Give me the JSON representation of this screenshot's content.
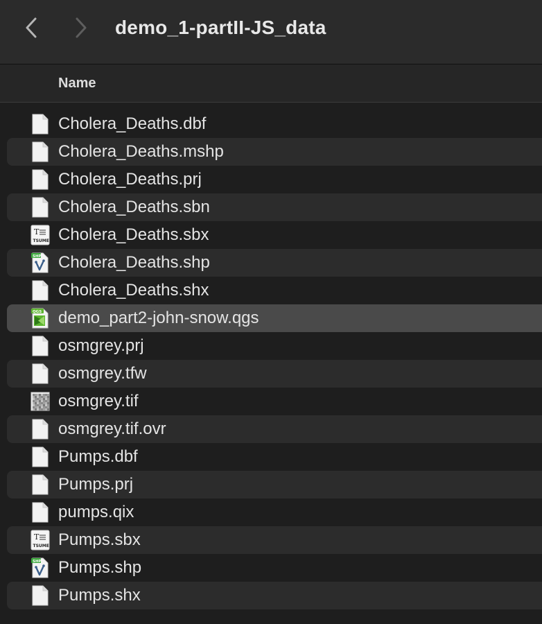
{
  "window": {
    "title": "demo_1-partII-JS_data"
  },
  "header": {
    "name_column": "Name"
  },
  "files": [
    {
      "name": "Cholera_Deaths.dbf",
      "icon": "generic-file-icon"
    },
    {
      "name": "Cholera_Deaths.mshp",
      "icon": "generic-file-icon"
    },
    {
      "name": "Cholera_Deaths.prj",
      "icon": "generic-file-icon"
    },
    {
      "name": "Cholera_Deaths.sbn",
      "icon": "generic-file-icon"
    },
    {
      "name": "Cholera_Deaths.sbx",
      "icon": "tsume-file-icon",
      "icon_text": "TSUME"
    },
    {
      "name": "Cholera_Deaths.shp",
      "icon": "shp-file-icon",
      "icon_text": "SHP"
    },
    {
      "name": "Cholera_Deaths.shx",
      "icon": "generic-file-icon"
    },
    {
      "name": "demo_part2-john-snow.qgs",
      "icon": "qgs-file-icon",
      "icon_text": "QGS",
      "selected": true
    },
    {
      "name": "osmgrey.prj",
      "icon": "generic-file-icon"
    },
    {
      "name": "osmgrey.tfw",
      "icon": "generic-file-icon"
    },
    {
      "name": "osmgrey.tif",
      "icon": "image-thumbnail-icon"
    },
    {
      "name": "osmgrey.tif.ovr",
      "icon": "generic-file-icon"
    },
    {
      "name": "Pumps.dbf",
      "icon": "generic-file-icon"
    },
    {
      "name": "Pumps.prj",
      "icon": "generic-file-icon"
    },
    {
      "name": "pumps.qix",
      "icon": "generic-file-icon"
    },
    {
      "name": "Pumps.sbx",
      "icon": "tsume-file-icon",
      "icon_text": "TSUME"
    },
    {
      "name": "Pumps.shp",
      "icon": "shp-file-icon",
      "icon_text": "SHP"
    },
    {
      "name": "Pumps.shx",
      "icon": "generic-file-icon"
    }
  ],
  "colors": {
    "background": "#1e1e1e",
    "row_alt": "#2c2c2c",
    "row_selected": "#4a4a4a",
    "shp_green": "#3aa83a",
    "qgs_green": "#5db52f"
  }
}
